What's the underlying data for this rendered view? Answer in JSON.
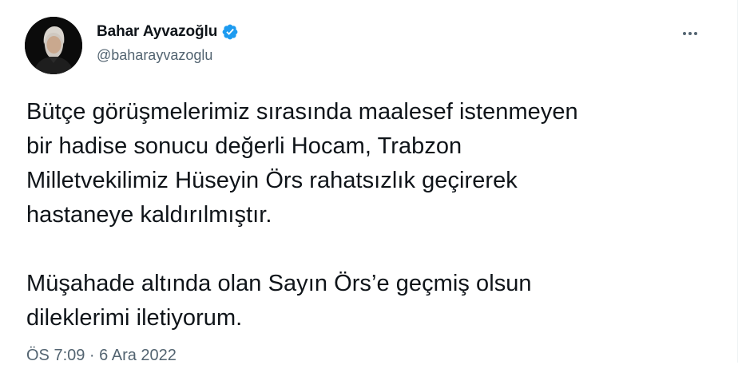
{
  "author": {
    "display_name": "Bahar Ayvazoğlu",
    "handle": "@baharayvazoglu",
    "verified": true
  },
  "icons": {
    "verified": "verified-badge-icon",
    "more": "more-options-icon"
  },
  "tweet": {
    "paragraphs": [
      [
        "Bütçe görüşmelerimiz sırasında maalesef istenmeyen",
        "bir hadise sonucu değerli Hocam, Trabzon",
        "Milletvekilimiz Hüseyin Örs rahatsızlık geçirerek",
        "hastaneye kaldırılmıştır."
      ],
      [
        "Müşahade altında olan Sayın Örs’e geçmiş olsun",
        "dileklerimi iletiyorum."
      ]
    ],
    "timestamp": "ÖS 7:09 · 6 Ara 2022"
  },
  "colors": {
    "text": "#0f1419",
    "secondary": "#536471",
    "verified_blue": "#1d9bf0"
  }
}
